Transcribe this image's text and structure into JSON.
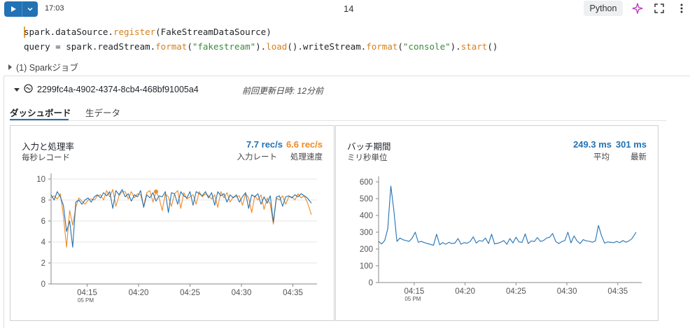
{
  "toolbar": {
    "time": "17:03",
    "cell_number": "14",
    "language": "Python"
  },
  "code": {
    "line1": {
      "a": "spark.dataSource.",
      "b": "register",
      "c": "(FakeStreamDataSource)"
    },
    "line2": {
      "a": "query = spark.readStream.",
      "b": "format",
      "c": "(",
      "d": "\"fakestream\"",
      "e": ").",
      "f": "load",
      "g": "().writeStream.",
      "h": "format",
      "i": "(",
      "j": "\"console\"",
      "k": ").",
      "l": "start",
      "m": "()"
    }
  },
  "jobs_label": "(1) Sparkジョブ",
  "stream": {
    "id": "2299fc4a-4902-4374-8cb4-468bf91005a4",
    "updated": "前回更新日時: 12分前"
  },
  "tabs": [
    "ダッシュボード",
    "生データ"
  ],
  "colors": {
    "blue": "#2272b4",
    "orange": "#f08a24"
  },
  "chart1": {
    "title": "入力と処理率",
    "subtitle": "毎秒レコード",
    "input_rate": "7.7 rec/s",
    "input_label": "入力レート",
    "process_rate": "6.6 rec/s",
    "process_label": "処理速度"
  },
  "chart2": {
    "title": "バッチ期間",
    "subtitle": "ミリ秒単位",
    "avg": "249.3 ms",
    "avg_label": "平均",
    "latest": "301 ms",
    "latest_label": "最新"
  },
  "chart_data": [
    {
      "type": "line",
      "title": "入力と処理率",
      "ylim": [
        0,
        10
      ],
      "y_ticks": [
        "0",
        "2",
        "4",
        "6",
        "8",
        "10"
      ],
      "x_ticks": [
        "04:15",
        "04:20",
        "04:25",
        "04:30",
        "04:35"
      ],
      "x_tick_sub": "05 PM",
      "x_range_min": [
        11.5,
        36.8
      ],
      "grid": "horizontal",
      "series": [
        {
          "name": "入力レート",
          "color": "#2272b4",
          "x": [
            11.5,
            11.8,
            12.1,
            12.4,
            12.7,
            13.0,
            13.3,
            13.6,
            13.9,
            14.2,
            14.5,
            14.8,
            15.1,
            15.4,
            15.7,
            16.0,
            16.3,
            16.6,
            16.9,
            17.2,
            17.5,
            17.8,
            18.1,
            18.4,
            18.7,
            19.0,
            19.3,
            19.6,
            19.9,
            20.2,
            20.5,
            20.8,
            21.1,
            21.4,
            21.7,
            22.0,
            22.3,
            22.6,
            22.9,
            23.2,
            23.5,
            23.8,
            24.1,
            24.4,
            24.7,
            25.0,
            25.3,
            25.6,
            25.9,
            26.2,
            26.5,
            26.8,
            27.1,
            27.4,
            27.7,
            28.0,
            28.3,
            28.6,
            28.9,
            29.2,
            29.5,
            29.8,
            30.1,
            30.4,
            30.7,
            31.0,
            31.3,
            31.6,
            31.9,
            32.2,
            32.5,
            32.8,
            33.1,
            33.4,
            33.7,
            34.0,
            34.3,
            34.6,
            34.9,
            35.2,
            35.5,
            35.8,
            36.1,
            36.4,
            36.8
          ],
          "y": [
            8.5,
            8.0,
            8.8,
            8.3,
            7.5,
            5.0,
            6.0,
            3.5,
            7.8,
            8.0,
            7.6,
            8.0,
            8.2,
            7.8,
            8.3,
            8.5,
            8.2,
            8.7,
            8.4,
            8.8,
            7.2,
            8.9,
            8.5,
            9.0,
            8.3,
            8.6,
            7.9,
            8.5,
            8.3,
            8.9,
            7.3,
            8.5,
            8.2,
            8.7,
            7.9,
            8.4,
            8.3,
            8.8,
            6.8,
            8.7,
            8.6,
            7.6,
            8.8,
            8.4,
            8.2,
            8.8,
            7.5,
            8.8,
            8.6,
            8.4,
            8.8,
            8.2,
            8.7,
            7.5,
            8.8,
            8.4,
            8.6,
            7.8,
            8.5,
            8.2,
            8.5,
            7.8,
            8.3,
            8.7,
            7.2,
            8.5,
            8.3,
            8.6,
            7.6,
            8.3,
            7.7,
            8.4,
            5.9,
            8.3,
            8.4,
            7.4,
            8.3,
            8.4,
            8.2,
            8.5,
            8.3,
            8.6,
            8.4,
            8.2,
            7.7
          ]
        },
        {
          "name": "処理速度",
          "color": "#f08a24",
          "x": [
            11.5,
            11.8,
            12.1,
            12.4,
            12.7,
            13.0,
            13.3,
            13.6,
            13.9,
            14.2,
            14.5,
            14.8,
            15.1,
            15.4,
            15.7,
            16.0,
            16.3,
            16.6,
            16.9,
            17.2,
            17.5,
            17.8,
            18.1,
            18.4,
            18.7,
            19.0,
            19.3,
            19.6,
            19.9,
            20.2,
            20.5,
            20.8,
            21.1,
            21.4,
            21.7,
            22.0,
            22.3,
            22.6,
            22.9,
            23.2,
            23.5,
            23.8,
            24.1,
            24.4,
            24.7,
            25.0,
            25.3,
            25.6,
            25.9,
            26.2,
            26.5,
            26.8,
            27.1,
            27.4,
            27.7,
            28.0,
            28.3,
            28.6,
            28.9,
            29.2,
            29.5,
            29.8,
            30.1,
            30.4,
            30.7,
            31.0,
            31.3,
            31.6,
            31.9,
            32.2,
            32.5,
            32.8,
            33.1,
            33.4,
            33.7,
            34.0,
            34.3,
            34.6,
            34.9,
            35.2,
            35.5,
            35.8,
            36.1,
            36.4,
            36.8
          ],
          "y": [
            8.2,
            8.4,
            8.1,
            8.6,
            6.5,
            3.5,
            7.0,
            5.6,
            7.3,
            8.2,
            7.9,
            7.6,
            8.0,
            8.1,
            8.0,
            8.4,
            8.5,
            8.0,
            8.9,
            8.3,
            9.0,
            7.4,
            8.4,
            8.8,
            8.8,
            8.1,
            8.8,
            8.2,
            8.6,
            8.5,
            7.4,
            8.7,
            8.9,
            7.8,
            8.8,
            8.2,
            7.0,
            8.6,
            8.3,
            7.4,
            8.6,
            8.9,
            7.2,
            8.7,
            8.1,
            8.3,
            8.5,
            7.6,
            8.8,
            8.3,
            8.6,
            8.4,
            8.1,
            8.5,
            7.3,
            8.8,
            8.2,
            8.7,
            7.8,
            8.3,
            8.3,
            8.4,
            7.5,
            8.6,
            8.2,
            6.8,
            8.4,
            8.0,
            8.5,
            7.1,
            8.2,
            7.6,
            5.7,
            8.2,
            8.0,
            8.4,
            7.6,
            8.3,
            8.3,
            8.0,
            8.6,
            8.2,
            8.4,
            7.8,
            6.6
          ]
        }
      ]
    },
    {
      "type": "line",
      "title": "バッチ期間",
      "ylim": [
        0,
        600
      ],
      "y_ticks": [
        "0",
        "100",
        "200",
        "300",
        "400",
        "500",
        "600"
      ],
      "x_ticks": [
        "04:15",
        "04:20",
        "04:25",
        "04:30",
        "04:35"
      ],
      "x_tick_sub": "05 PM",
      "x_range_min": [
        11.5,
        36.8
      ],
      "grid": "none",
      "series": [
        {
          "name": "バッチ期間",
          "color": "#2272b4",
          "x": [
            11.5,
            11.8,
            12.1,
            12.4,
            12.7,
            13.0,
            13.3,
            13.6,
            13.9,
            14.2,
            14.5,
            14.8,
            15.1,
            15.4,
            15.7,
            16.0,
            16.3,
            16.6,
            16.9,
            17.2,
            17.5,
            17.8,
            18.1,
            18.4,
            18.7,
            19.0,
            19.3,
            19.6,
            19.9,
            20.2,
            20.5,
            20.8,
            21.1,
            21.4,
            21.7,
            22.0,
            22.3,
            22.6,
            22.9,
            23.2,
            23.5,
            23.8,
            24.1,
            24.4,
            24.7,
            25.0,
            25.3,
            25.6,
            25.9,
            26.2,
            26.5,
            26.8,
            27.1,
            27.4,
            27.7,
            28.0,
            28.3,
            28.6,
            28.9,
            29.2,
            29.5,
            29.8,
            30.1,
            30.4,
            30.7,
            31.0,
            31.3,
            31.6,
            31.9,
            32.2,
            32.5,
            32.8,
            33.1,
            33.4,
            33.7,
            34.0,
            34.3,
            34.6,
            34.9,
            35.2,
            35.5,
            35.8,
            36.1,
            36.4,
            36.8
          ],
          "y": [
            245,
            230,
            250,
            320,
            575,
            430,
            245,
            265,
            255,
            250,
            245,
            265,
            300,
            240,
            245,
            238,
            232,
            228,
            222,
            288,
            225,
            238,
            228,
            240,
            232,
            235,
            262,
            228,
            238,
            234,
            245,
            272,
            235,
            250,
            246,
            265,
            232,
            288,
            230,
            234,
            240,
            250,
            228,
            262,
            236,
            270,
            242,
            240,
            290,
            232,
            248,
            244,
            268,
            245,
            250,
            265,
            270,
            292,
            245,
            232,
            244,
            250,
            300,
            236,
            278,
            248,
            232,
            256,
            248,
            246,
            240,
            248,
            340,
            280,
            235,
            242,
            240,
            238,
            245,
            238,
            250,
            240,
            248,
            262,
            300
          ]
        }
      ]
    }
  ]
}
